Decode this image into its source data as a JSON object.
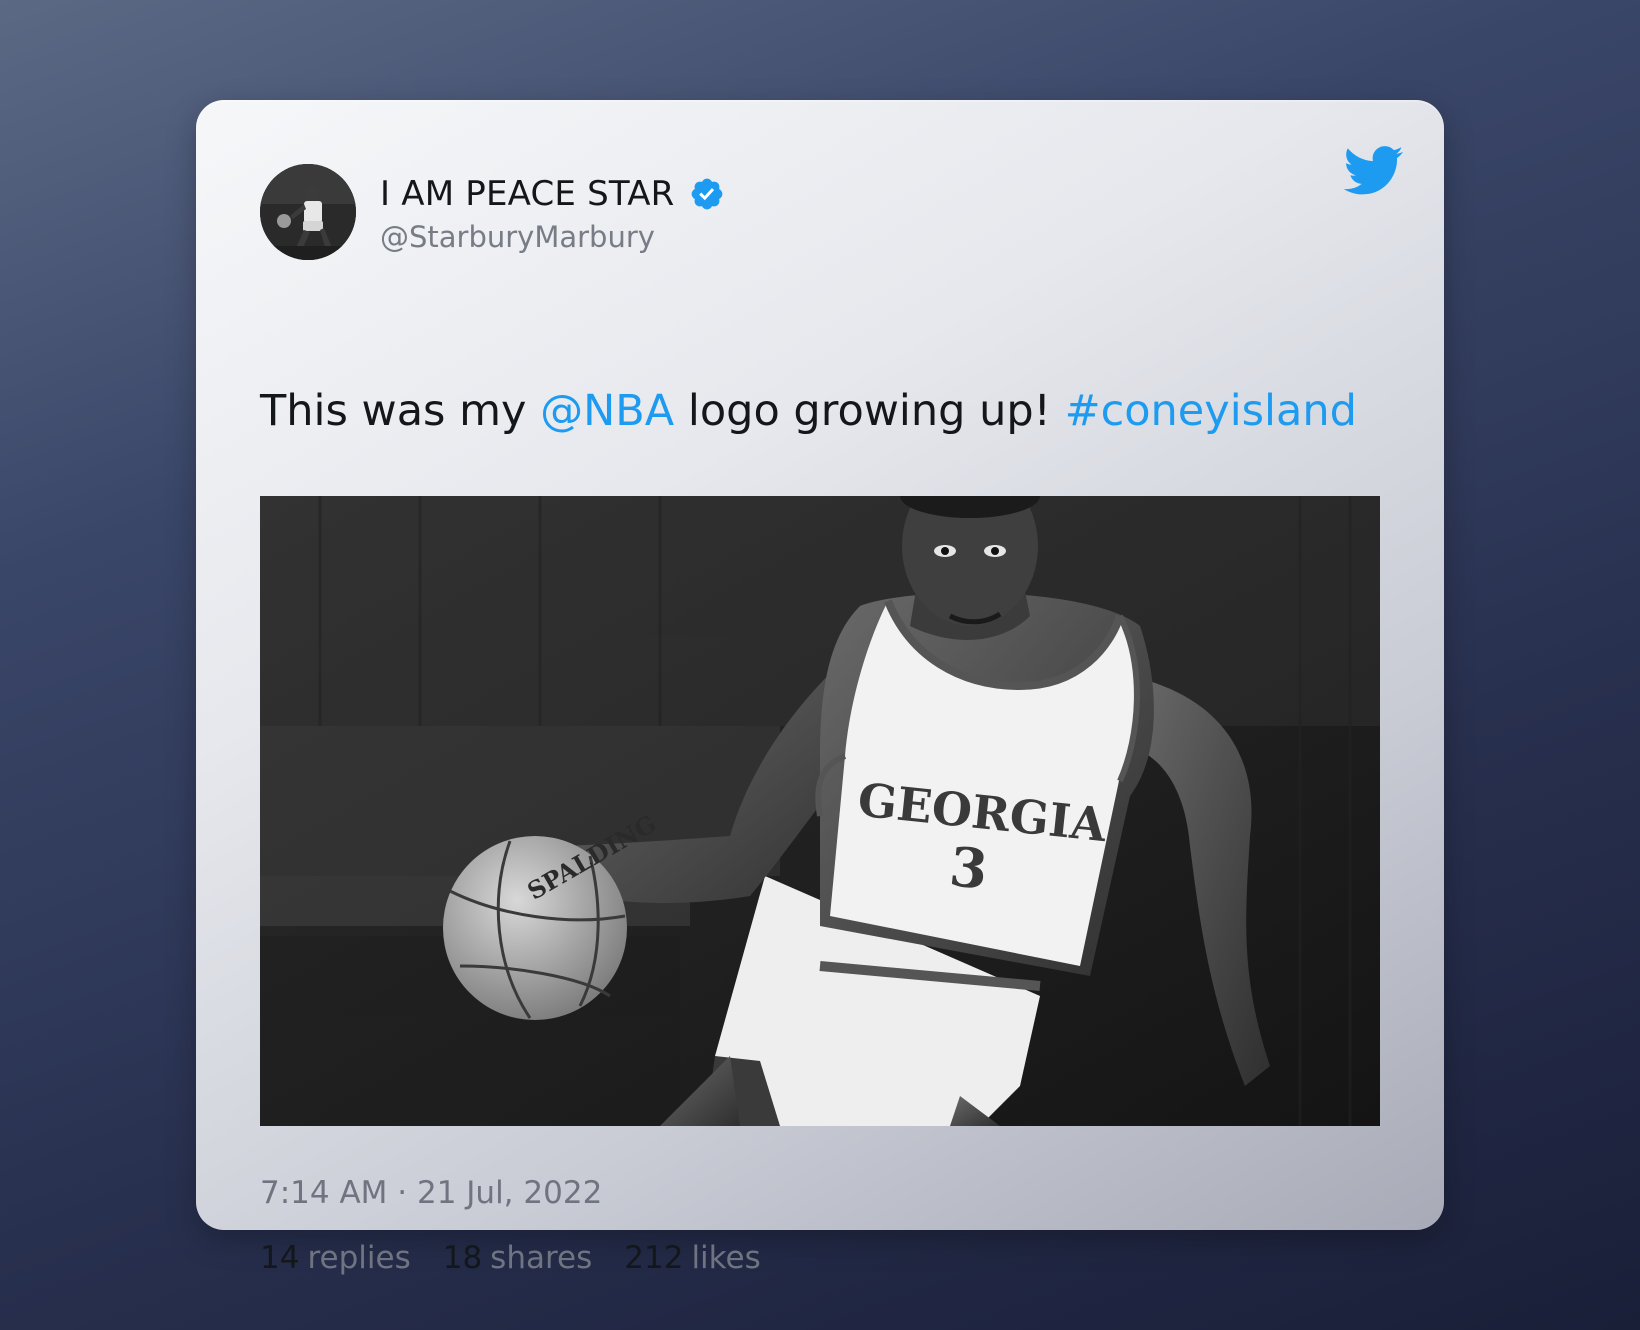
{
  "author": {
    "name": "I AM PEACE STAR",
    "handle": "@StarburyMarbury",
    "verified": true,
    "avatar_icon": "basketball-player-avatar"
  },
  "tweet": {
    "text_parts": [
      "This was my ",
      "@NBA",
      " logo growing up! ",
      "#coneyisland"
    ],
    "timestamp": "7:14 AM · 21 Jul, 2022",
    "media": {
      "jersey_text": "GEORGIA",
      "jersey_number": "3",
      "ball_text": "SPALDING"
    }
  },
  "stats": {
    "replies_count": "14",
    "replies_label": "replies",
    "shares_count": "18",
    "shares_label": "shares",
    "likes_count": "212",
    "likes_label": "likes"
  },
  "colors": {
    "link": "#1d9bf0",
    "twitter_brand": "#1d9bf0",
    "text_primary": "#14171a",
    "text_secondary": "#6f7480"
  }
}
